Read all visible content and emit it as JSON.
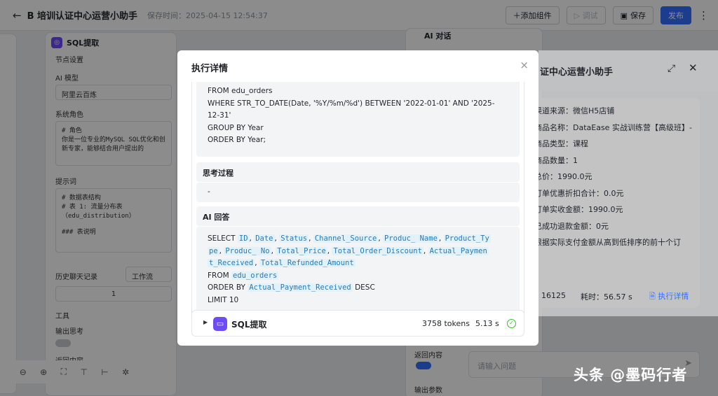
{
  "header": {
    "back_icon": "arrow-left-icon",
    "app_title": "B 培训认证中心运营小助手",
    "save_time": "保存时间：2025-04-15 12:54:37",
    "add_component": "＋添加组件",
    "debug": "▷ 调试",
    "save": "保存",
    "publish": "发布"
  },
  "sql_node": {
    "title": "SQL提取",
    "section": "节点设置",
    "ai_model_label": "AI 模型",
    "ai_model_value": "阿里云百炼",
    "system_role_label": "系统角色",
    "system_role_text": "# 角色\n你是一位专业的MySQL SQL优化和创新专家，能够结合用户提出的",
    "prompt_label": "提示词",
    "prompt_text": "# 数据表结构\n# 表 1: 流量分布表\n（edu_distribution）\n\n### 表说明",
    "history_label": "历史聊天记录",
    "history_select": "工作流",
    "history_value": "1",
    "tools_label": "工具",
    "output_think_label": "输出思考",
    "return_content_label": "返回内容"
  },
  "ai_chat_node": {
    "title": "AI 对话",
    "return_content_label": "返回内容",
    "output_params_label": "输出参数",
    "input_placeholder": "请输入问题"
  },
  "chat_preview": {
    "title": "证中心运营小助手",
    "lines": [
      "渠道来源：微信H5店铺",
      "商品名称：DataEase 实战训练营【高级班】-",
      "商品类型：课程",
      "商品数量：1",
      "总价：1990.0元",
      "订单优惠折扣合计：0.0元",
      "订单实收金额：1990.0元",
      "已成功退款金额：0元",
      "根据实际支付金额从高到低排序的前十个订"
    ],
    "token_count": "16125",
    "elapsed": "耗时：56.57 s",
    "exec_detail_link": "执行详情"
  },
  "modal": {
    "title": "执行详情",
    "sql_lines": [
      "FROM edu_orders",
      "WHERE STR_TO_DATE(Date, '%Y/%m/%d') BETWEEN '2022-01-01' AND '2025-",
      "12-31'",
      "GROUP BY Year",
      "ORDER BY Year;"
    ],
    "thinking_title": "思考过程",
    "thinking_content": "-",
    "answer_title": "AI 回答",
    "answer_select": "SELECT",
    "answer_columns": [
      "ID",
      "Date",
      "Status",
      "Channel_Source",
      "Produc_ Name",
      "Product_Ty",
      "pe",
      "Produc_ No",
      "Total_Price",
      "Total_Order_Discount",
      "Actual_Paymen",
      "t_Received",
      "Total_Refunded_Amount"
    ],
    "answer_from": "FROM",
    "answer_table": "edu_orders",
    "answer_order_by": "ORDER BY",
    "answer_order_col": "Actual_Payment_Received",
    "answer_desc": "DESC",
    "answer_limit": "LIMIT 10",
    "step_name": "SQL提取",
    "step_tokens": "3758 tokens",
    "step_time": "5.13 s"
  },
  "watermark": "头条 @墨码行者"
}
